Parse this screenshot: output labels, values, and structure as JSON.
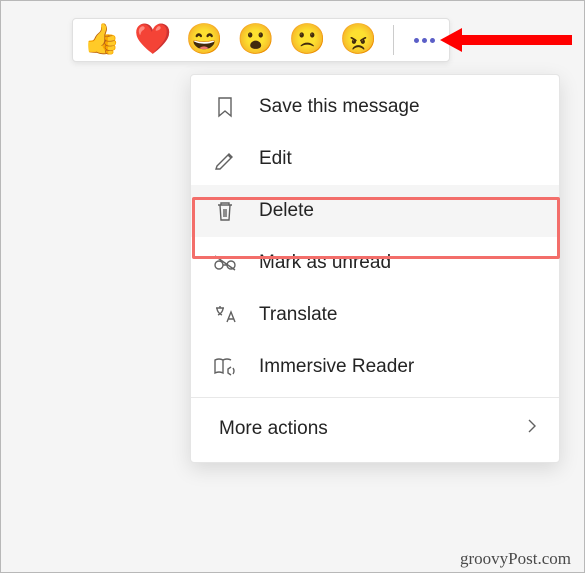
{
  "reactions": {
    "thumbs_up": "👍",
    "heart": "❤️",
    "laugh": "😄",
    "surprised": "😮",
    "sad": "🙁",
    "angry": "😠"
  },
  "menu": {
    "save": "Save this message",
    "edit": "Edit",
    "delete": "Delete",
    "mark_unread": "Mark as unread",
    "translate": "Translate",
    "immersive": "Immersive Reader",
    "more_actions": "More actions"
  },
  "watermark": "groovyPost.com"
}
